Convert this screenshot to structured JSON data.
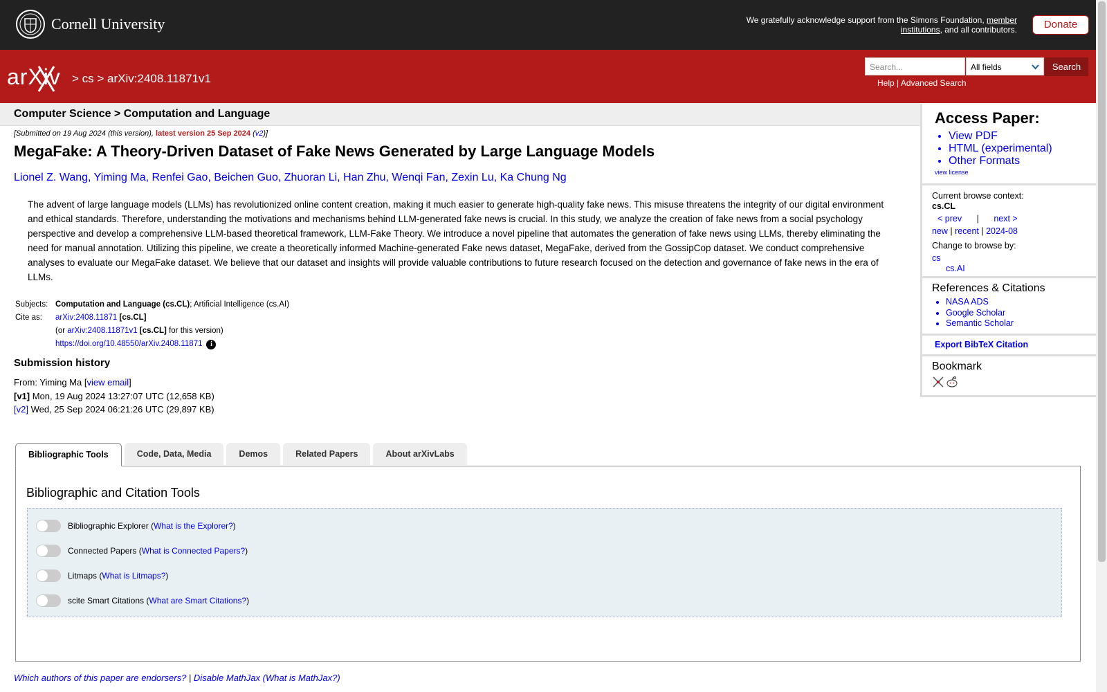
{
  "topbar": {
    "university": "Cornell University",
    "ack_prefix": "We gratefully acknowledge support from the Simons Foundation, ",
    "ack_link": "member institutions",
    "ack_suffix": ", and all contributors.",
    "donate_label": "Donate"
  },
  "header": {
    "logo_text": "arXiv",
    "breadcrumb": [
      "cs",
      "arXiv:2408.11871v1"
    ],
    "search_placeholder": "Search...",
    "search_field": "All fields",
    "search_button": "Search",
    "help_link": "Help",
    "advanced_link": "Advanced Search"
  },
  "subject_header": "Computer Science > Computation and Language",
  "submitted": {
    "prefix": "[Submitted on 19 Aug 2024 (this version), ",
    "latest": "latest version 25 Sep 2024",
    "v2": "v2",
    "open": " (",
    "close": ")]"
  },
  "paper": {
    "title": "MegaFake: A Theory-Driven Dataset of Fake News Generated by Large Language Models",
    "authors": [
      "Lionel Z. Wang",
      "Yiming Ma",
      "Renfei Gao",
      "Beichen Guo",
      "Zhuoran Li",
      "Han Zhu",
      "Wenqi Fan",
      "Zexin Lu",
      "Ka Chung Ng"
    ],
    "abstract": "The advent of large language models (LLMs) has revolutionized online content creation, making it much easier to generate high-quality fake news. This misuse threatens the integrity of our digital environment and ethical standards. Therefore, understanding the motivations and mechanisms behind LLM-generated fake news is crucial. In this study, we analyze the creation of fake news from a social psychology perspective and develop a comprehensive LLM-based theoretical framework, LLM-Fake Theory. We introduce a novel pipeline that automates the generation of fake news using LLMs, thereby eliminating the need for manual annotation. Utilizing this pipeline, we create a theoretically informed Machine-generated Fake news dataset, MegaFake, derived from the GossipCop dataset. We conduct comprehensive analyses to evaluate our MegaFake dataset. We believe that our dataset and insights will provide valuable contributions to future research focused on the detection and governance of fake news in the era of LLMs."
  },
  "meta": {
    "subjects_label": "Subjects:",
    "subjects_primary": "Computation and Language (cs.CL)",
    "subjects_rest": "; Artificial Intelligence (cs.AI)",
    "cite_label": "Cite as:",
    "cite_id": "arXiv:2408.11871",
    "cite_tag": "[cs.CL]",
    "cite_or": "(or ",
    "cite_version_id": "arXiv:2408.11871v1",
    "cite_version_tag": "[cs.CL]",
    "cite_version_suffix": " for this version)",
    "doi": "https://doi.org/10.48550/arXiv.2408.11871"
  },
  "history": {
    "heading": "Submission history",
    "from_prefix": "From: Yiming Ma [",
    "view_email": "view email",
    "from_suffix": "]",
    "v1_label": "[v1]",
    "v1_text": " Mon, 19 Aug 2024 13:27:07 UTC (12,658 KB)",
    "v2_label": "[v2]",
    "v2_text": " Wed, 25 Sep 2024 06:21:26 UTC (29,897 KB)"
  },
  "sidebar": {
    "access_title": "Access Paper:",
    "access_links": [
      "View PDF",
      "HTML (experimental)",
      "Other Formats"
    ],
    "view_license": "view license",
    "browse_context_label": "Current browse context:",
    "browse_context": "cs.CL",
    "prev": "< prev",
    "sep": "|",
    "next": "next >",
    "new": "new",
    "recent": "recent",
    "month": "2024-08",
    "change_browse": "Change to browse by:",
    "browse_cs": "cs",
    "browse_csai": "cs.AI",
    "refs_title": "References & Citations",
    "refs_links": [
      "NASA ADS",
      "Google Scholar",
      "Semantic Scholar"
    ],
    "export_bibtex": "Export BibTeX Citation",
    "bookmark_title": "Bookmark"
  },
  "tabs": [
    "Bibliographic Tools",
    "Code, Data, Media",
    "Demos",
    "Related Papers",
    "About arXivLabs"
  ],
  "tabpanel": {
    "heading": "Bibliographic and Citation Tools",
    "tools": [
      {
        "name": "Bibliographic Explorer",
        "link": "What is the Explorer?"
      },
      {
        "name": "Connected Papers",
        "link": "What is Connected Papers?"
      },
      {
        "name": "Litmaps",
        "link": "What is Litmaps?"
      },
      {
        "name": "scite Smart Citations",
        "link": "What are Smart Citations?"
      }
    ]
  },
  "footer": {
    "endorsers": "Which authors of this paper are endorsers?",
    "sep": " | ",
    "disable_mathjax": "Disable MathJax",
    "open": " (",
    "what_mathjax": "What is MathJax?",
    "close": ")"
  }
}
